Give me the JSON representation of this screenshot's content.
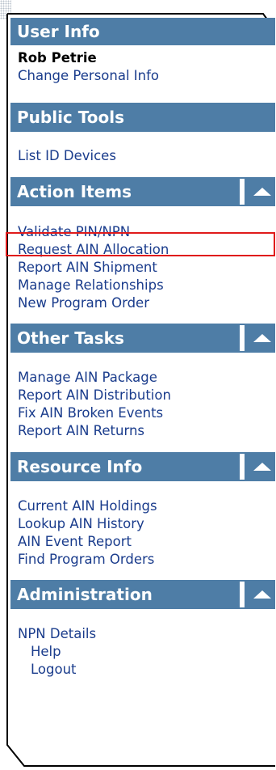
{
  "user_info": {
    "header": "User Info",
    "name": "Rob Petrie",
    "change_link": "Change Personal Info"
  },
  "public_tools": {
    "header": "Public Tools",
    "links": [
      "List ID Devices"
    ]
  },
  "action_items": {
    "header": "Action Items",
    "links": [
      "Validate PIN/NPN",
      "Request AIN Allocation",
      "Report AIN Shipment",
      "Manage Relationships",
      "New Program Order"
    ]
  },
  "other_tasks": {
    "header": "Other Tasks",
    "links": [
      "Manage AIN Package",
      "Report AIN Distribution",
      "Fix AIN Broken Events",
      "Report AIN Returns"
    ]
  },
  "resource_info": {
    "header": "Resource Info",
    "links": [
      "Current AIN Holdings",
      "Lookup AIN History",
      "AIN Event Report",
      "Find Program Orders"
    ]
  },
  "administration": {
    "header": "Administration",
    "links": [
      "NPN Details",
      "Help",
      "Logout"
    ]
  },
  "colors": {
    "header_bg": "#4e7da6",
    "link": "#1a3c8c",
    "highlight": "#e01b1b"
  },
  "icons": {
    "collapse": "triangle-up-icon"
  }
}
